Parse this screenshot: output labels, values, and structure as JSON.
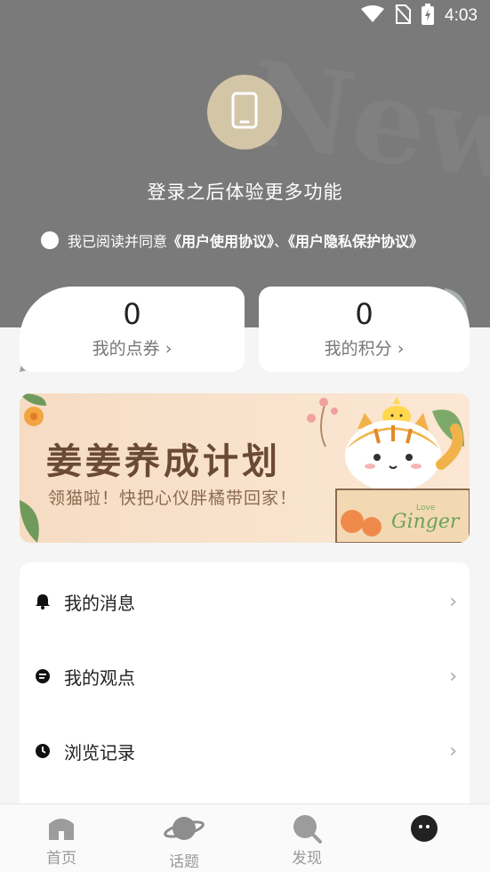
{
  "status_bar": {
    "time": "4:03"
  },
  "header": {
    "login_prompt": "登录之后体验更多功能",
    "agreement_prefix": "我已阅读并同意",
    "user_agreement": "《用户使用协议》",
    "separator": "、",
    "privacy_agreement": "《用户隐私保护协议》"
  },
  "stats": {
    "coupons": {
      "value": "0",
      "label": "我的点券 ›"
    },
    "points": {
      "value": "0",
      "label": "我的积分 ›"
    }
  },
  "banner": {
    "title": "姜姜养成计划",
    "subtitle": "领猫啦！快把心仪胖橘带回家！",
    "box_text": "Ginger",
    "box_small": "Love"
  },
  "menu": {
    "items": [
      {
        "label": "我的消息",
        "icon": "bell-icon"
      },
      {
        "label": "我的观点",
        "icon": "chat-icon"
      },
      {
        "label": "浏览记录",
        "icon": "clock-icon"
      }
    ],
    "chevron": "›"
  },
  "bottom_nav": {
    "items": [
      {
        "label": "首页",
        "icon": "home-icon"
      },
      {
        "label": "话题",
        "icon": "planet-icon"
      },
      {
        "label": "发现",
        "icon": "discover-icon"
      },
      {
        "label": "",
        "icon": "profile-icon"
      }
    ]
  },
  "colors": {
    "header_bg": "#7a7a7a",
    "avatar_bg": "#d3c6a7",
    "banner_bg": "#f8e2cc",
    "nav_inactive": "#999999"
  }
}
